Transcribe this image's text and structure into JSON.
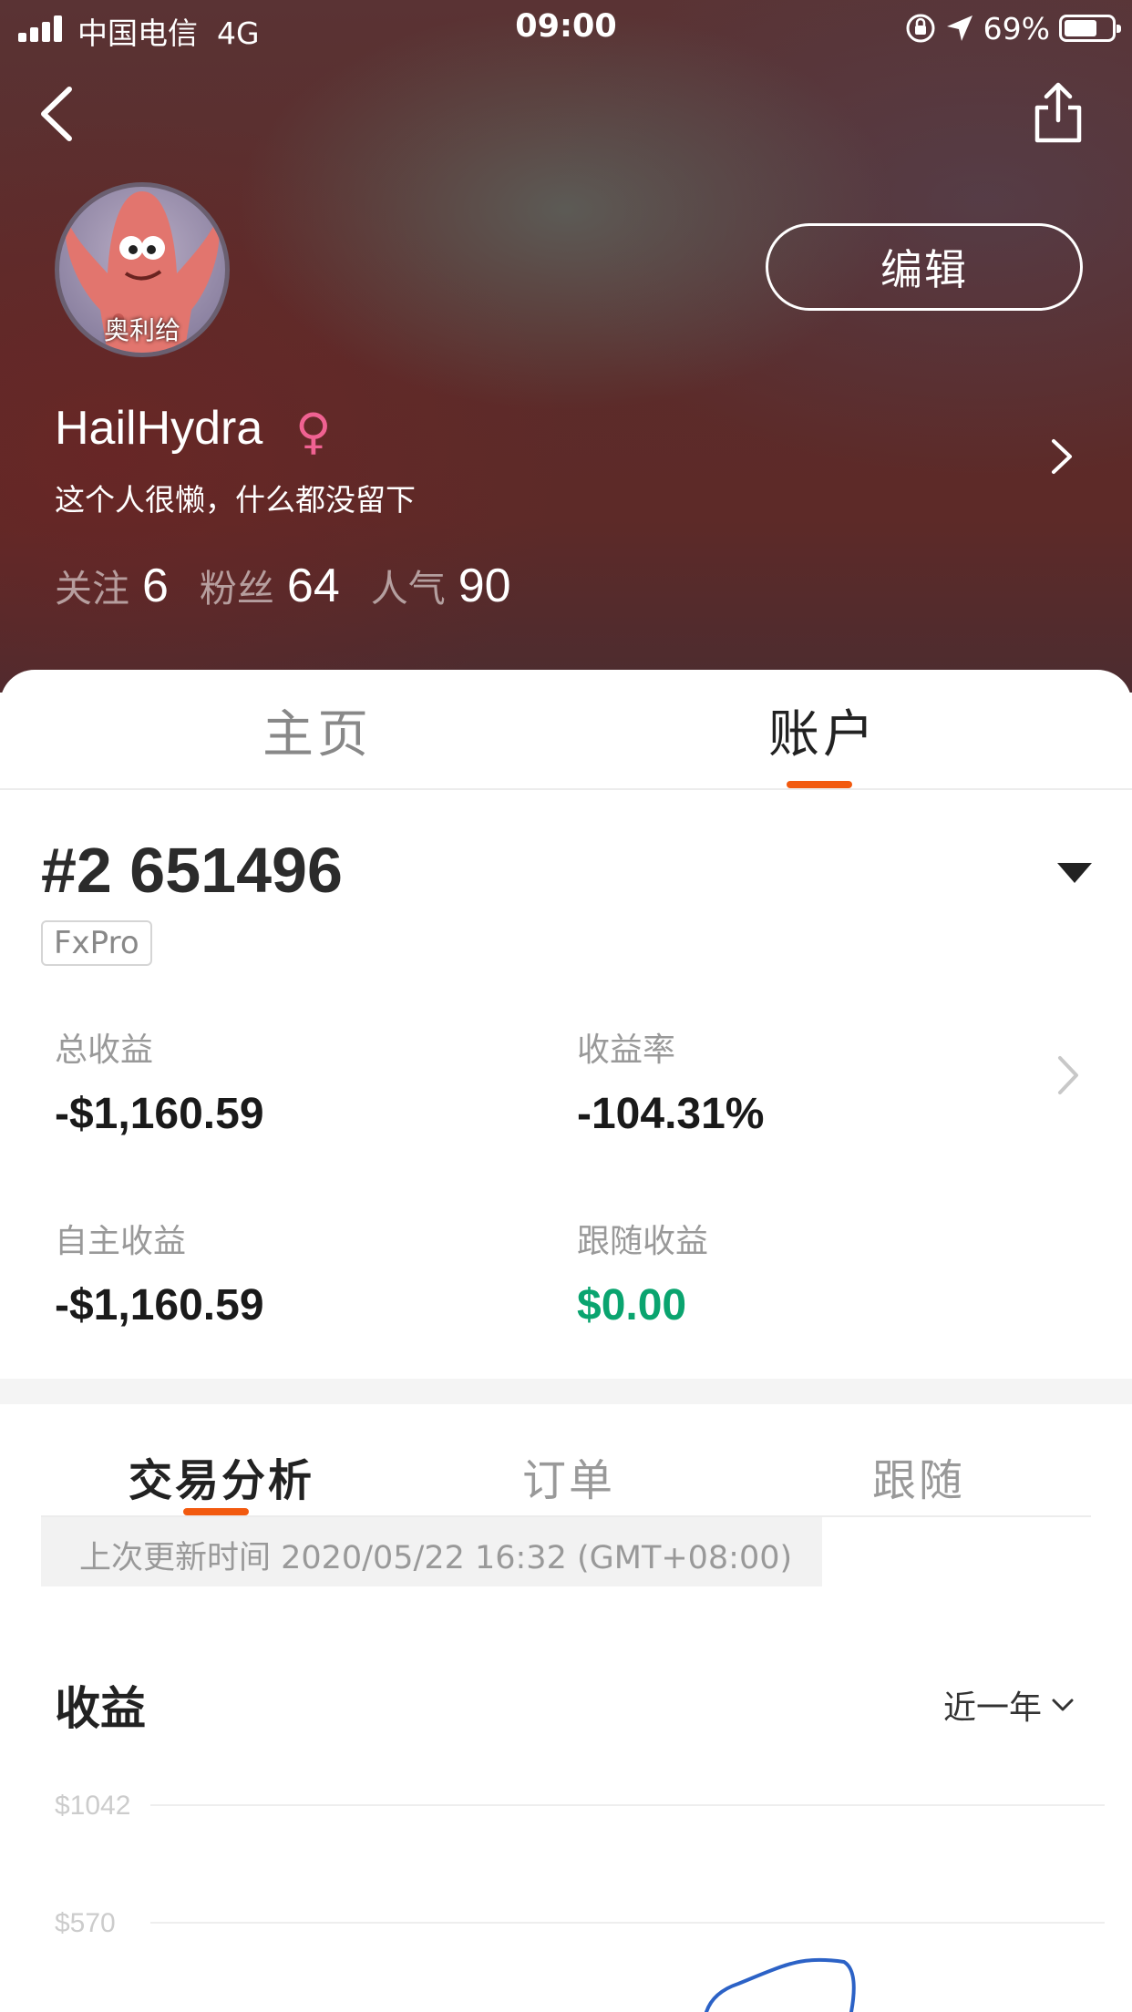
{
  "status_bar": {
    "carrier": "中国电信",
    "network": "4G",
    "time": "09:00",
    "battery_percent": "69%",
    "battery_level": 0.69
  },
  "profile": {
    "avatar_caption": "奥利给",
    "username": "HailHydra",
    "gender_symbol": "♀",
    "bio": "这个人很懒，什么都没留下",
    "edit_label": "编辑",
    "stats": [
      {
        "label": "关注",
        "value": "6"
      },
      {
        "label": "粉丝",
        "value": "64"
      },
      {
        "label": "人气",
        "value": "90"
      }
    ]
  },
  "main_tabs": [
    {
      "label": "主页",
      "active": false
    },
    {
      "label": "账户",
      "active": true
    }
  ],
  "account": {
    "number": "#2 651496",
    "broker": "FxPro",
    "metrics": [
      {
        "label": "总收益",
        "value": "-$1,160.59"
      },
      {
        "label": "收益率",
        "value": "-104.31%"
      },
      {
        "label": "自主收益",
        "value": "-$1,160.59"
      },
      {
        "label": "跟随收益",
        "value": "$0.00",
        "color": "#0aa46f"
      }
    ]
  },
  "sub_tabs": [
    {
      "label": "交易分析",
      "active": true
    },
    {
      "label": "订单",
      "active": false
    },
    {
      "label": "跟随",
      "active": false
    }
  ],
  "update_text": "上次更新时间 2020/05/22 16:32 (GMT+08:00)",
  "earnings": {
    "title": "收益",
    "period": "近一年"
  },
  "chart_data": {
    "type": "line",
    "title": "",
    "y_ticks": [
      "$1042",
      "$570"
    ],
    "y_tick_values": [
      1042,
      570
    ],
    "series_color": "#2c62c6",
    "note_visible_portion": "only upper part of chart visible; line enters near bottom edge",
    "series": [
      {
        "values": [
          {
            "x": 0.62,
            "y": 390
          },
          {
            "x": 0.66,
            "y": 460
          },
          {
            "x": 0.72,
            "y": 530
          },
          {
            "x": 0.74,
            "y": 470
          },
          {
            "x": 0.76,
            "y": 380
          }
        ]
      }
    ]
  },
  "icons": {
    "back": "back-arrow-icon",
    "share": "share-icon",
    "location": "location-arrow-icon",
    "rotation_lock": "rotation-lock-icon"
  }
}
